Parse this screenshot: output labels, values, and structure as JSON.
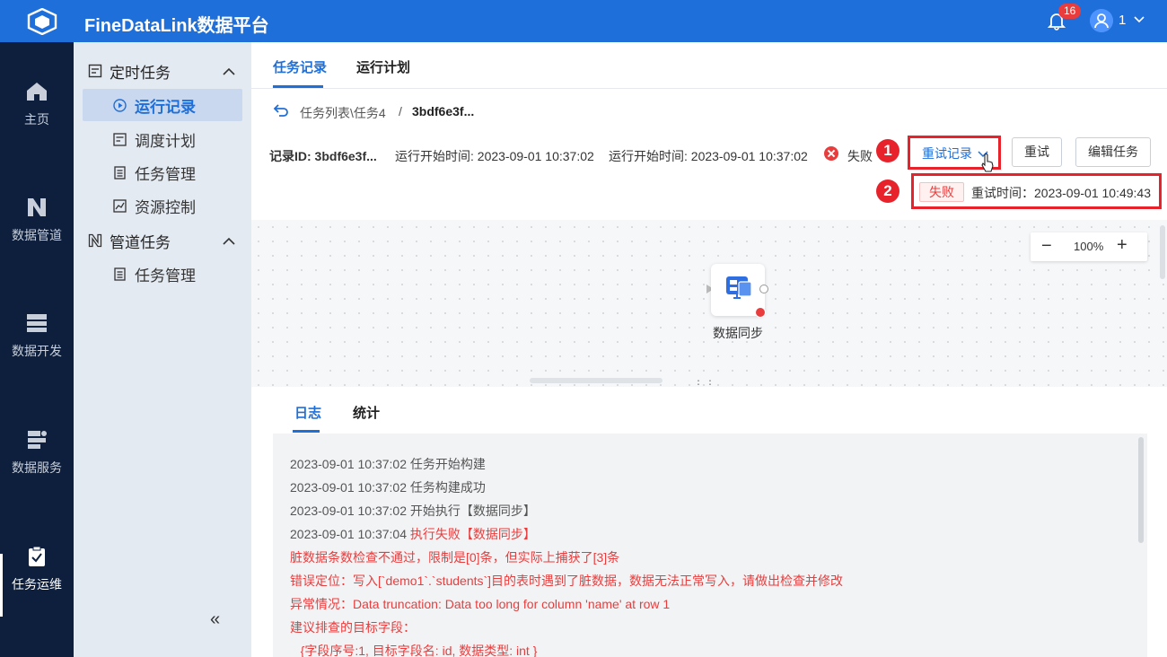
{
  "header": {
    "title": "FineDataLink数据平台",
    "notification_count": "16",
    "user_name": "1"
  },
  "leftnav": {
    "items": [
      {
        "label": "主页"
      },
      {
        "label": "数据管道"
      },
      {
        "label": "数据开发"
      },
      {
        "label": "数据服务"
      },
      {
        "label": "任务运维"
      }
    ]
  },
  "subnav": {
    "group1": "定时任务",
    "group1_items": [
      "运行记录",
      "调度计划",
      "任务管理",
      "资源控制"
    ],
    "group2": "管道任务",
    "group2_items": [
      "任务管理"
    ],
    "collapse": "«"
  },
  "tabs": [
    "任务记录",
    "运行计划"
  ],
  "breadcrumb": {
    "path": "任务列表\\任务4",
    "sep": "/",
    "current": "3bdf6e3f..."
  },
  "record": {
    "id_label": "记录ID: 3bdf6e3f...",
    "start1": "运行开始时间: 2023-09-01 10:37:02",
    "start2": "运行开始时间: 2023-09-01 10:37:02",
    "status": "失败"
  },
  "actions": {
    "retry_record": "重试记录",
    "retry": "重试",
    "edit": "编辑任务"
  },
  "callouts": [
    "1",
    "2"
  ],
  "retry_dropdown": {
    "status": "失败",
    "time": "重试时间：2023-09-01 10:49:43"
  },
  "canvas": {
    "zoom_minus": "−",
    "zoom": "100%",
    "zoom_plus": "+",
    "node_label": "数据同步",
    "drag": "⋮⋮"
  },
  "log": {
    "tabs": [
      "日志",
      "统计"
    ],
    "lines": [
      {
        "text": "2023-09-01 10:37:02 任务开始构建"
      },
      {
        "text": "2023-09-01 10:37:02 任务构建成功"
      },
      {
        "text": "2023-09-01 10:37:02 开始执行【数据同步】"
      },
      {
        "text": "2023-09-01 10:37:04 执行失败【数据同步】"
      },
      {
        "text": "脏数据条数检查不通过，限制是[0]条，但实际上捕获了[3]条"
      },
      {
        "text": "错误定位：写入[`demo1`.`students`]目的表时遇到了脏数据，数据无法正常写入，请做出检查并修改"
      },
      {
        "text": "异常情况：Data truncation: Data too long for column 'name' at row 1"
      },
      {
        "text": "建议排查的目标字段："
      },
      {
        "text": "   {字段序号:1, 目标字段名: id, 数据类型: int }"
      }
    ]
  },
  "colors": {
    "primary": "#1e6fd9",
    "error": "#e93d3d",
    "nav_bg": "#0d1f3c"
  }
}
